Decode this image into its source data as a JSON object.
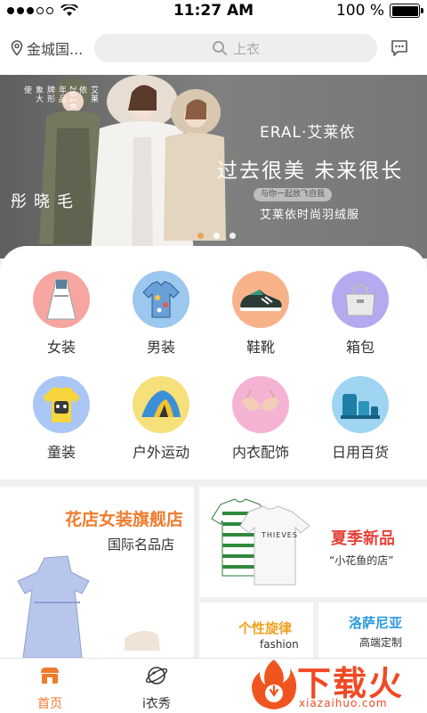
{
  "status_bar": {
    "time": "11:27 AM",
    "battery": "100 %"
  },
  "header": {
    "location": "金城国...",
    "search_placeholder": "上衣"
  },
  "banner": {
    "vertical_small": "艾莱依2018年品牌形象大使",
    "vertical_name": "毛晓彤",
    "brand": "ERAL·艾莱依",
    "slogan": "过去很美 未来很长",
    "pill": "与你一起放飞自我",
    "subslogan": "艾莱依时尚羽绒服",
    "slides": 3,
    "active_slide": 1
  },
  "categories": [
    {
      "label": "女装",
      "icon": "dress-icon",
      "color": "#f7a5a0"
    },
    {
      "label": "男装",
      "icon": "shirt-icon",
      "color": "#9cc7ef"
    },
    {
      "label": "鞋靴",
      "icon": "sneaker-icon",
      "color": "#f8b28a"
    },
    {
      "label": "箱包",
      "icon": "handbag-icon",
      "color": "#b5a9ef"
    },
    {
      "label": "童装",
      "icon": "kids-tshirt-icon",
      "color": "#aac6f5"
    },
    {
      "label": "户外运动",
      "icon": "tent-icon",
      "color": "#f6e07a"
    },
    {
      "label": "内衣配饰",
      "icon": "bra-icon",
      "color": "#f5b3d3"
    },
    {
      "label": "日用百货",
      "icon": "household-icon",
      "color": "#9fd5f3"
    }
  ],
  "promos": {
    "flagship": {
      "title": "花店女装旗舰店",
      "subtitle": "国际名品店"
    },
    "summer": {
      "title": "夏季新品",
      "subtitle": "“小花鱼的店”",
      "shirt_text": "THIEVES"
    },
    "personal": {
      "title": "个性旋律",
      "subtitle": "fashion"
    },
    "lozano": {
      "title": "洛萨尼亚",
      "subtitle": "高端定制"
    }
  },
  "tabbar": [
    {
      "label": "首页",
      "icon": "home-shop-icon",
      "active": true
    },
    {
      "label": "i衣秀",
      "icon": "planet-icon",
      "active": false
    }
  ],
  "watermark": {
    "text": "下载火",
    "url": "xiazaihuo.com"
  },
  "colors": {
    "accent": "#f07b2c",
    "banner_bg": "#7b7b7b"
  }
}
